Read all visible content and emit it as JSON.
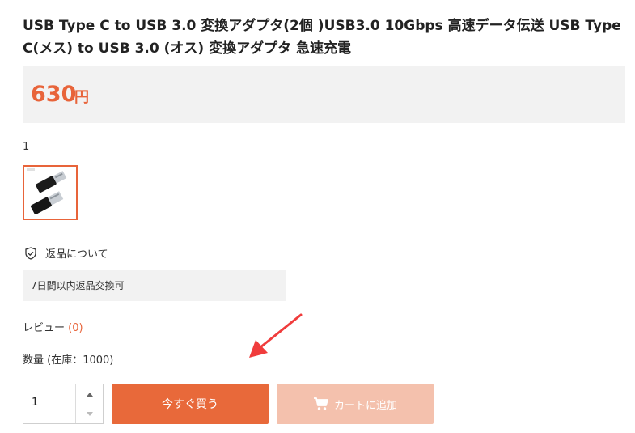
{
  "product": {
    "title": "USB Type C to USB 3.0 変換アダプタ(2個 )USB3.0 10Gbps 高速データ伝送 USB Type C(メス) to USB 3.0 (オス) 変換アダプタ 急速充電",
    "price": "630",
    "currency": "円"
  },
  "variant": {
    "label": "1"
  },
  "returns": {
    "heading": "返品について",
    "policy": "7日間以内返品交換可"
  },
  "review": {
    "label": "レビュー",
    "count": "(0)"
  },
  "quantity": {
    "label": "数量 (在庫：1000)",
    "value": "1"
  },
  "buttons": {
    "buy_now": "今すぐ買う",
    "add_to_cart": "カートに追加"
  },
  "colors": {
    "accent": "#e8693a",
    "cart_disabled": "#f4c1ad",
    "annotation_arrow": "#f03c3c"
  }
}
